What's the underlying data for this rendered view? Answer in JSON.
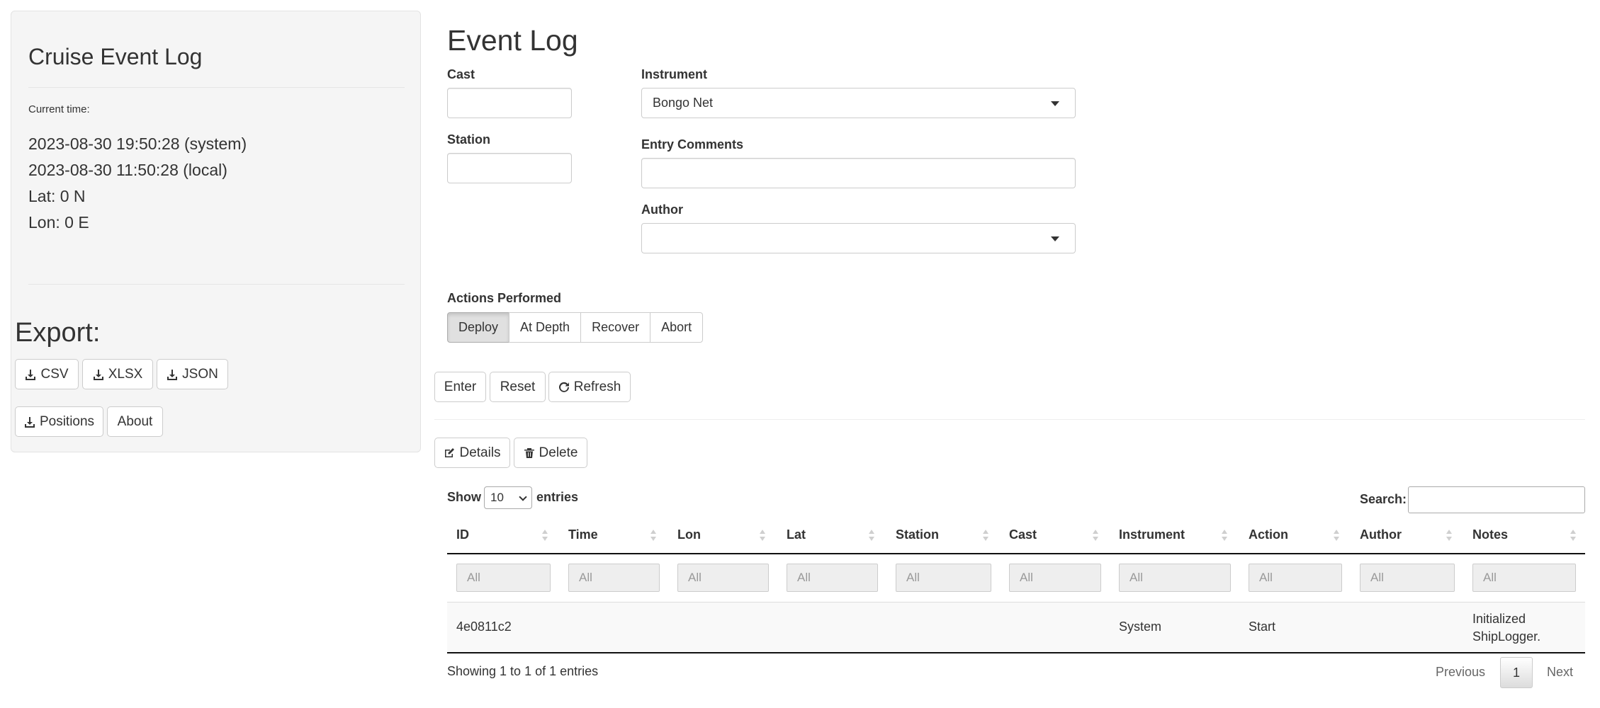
{
  "sidebar": {
    "title": "Cruise Event Log",
    "current_time_label": "Current time:",
    "system_time": "2023-08-30 19:50:28 (system)",
    "local_time": "2023-08-30 11:50:28 (local)",
    "lat": "Lat: 0 N",
    "lon": "Lon: 0 E",
    "export_heading": "Export:",
    "buttons": {
      "csv": "CSV",
      "xlsx": "XLSX",
      "json": "JSON",
      "positions": "Positions",
      "about": "About"
    }
  },
  "main": {
    "title": "Event Log",
    "form": {
      "cast_label": "Cast",
      "cast_value": "",
      "station_label": "Station",
      "station_value": "",
      "instrument_label": "Instrument",
      "instrument_value": "Bongo Net",
      "comments_label": "Entry Comments",
      "comments_value": "",
      "author_label": "Author",
      "author_value": ""
    },
    "actions": {
      "label": "Actions Performed",
      "options": [
        "Deploy",
        "At Depth",
        "Recover",
        "Abort"
      ],
      "selected": "Deploy"
    },
    "buttons": {
      "enter": "Enter",
      "reset": "Reset",
      "refresh": "Refresh",
      "details": "Details",
      "delete": "Delete"
    }
  },
  "table": {
    "show_label": "Show",
    "entries_label": "entries",
    "page_length": "10",
    "search_label": "Search:",
    "search_value": "",
    "columns": [
      "ID",
      "Time",
      "Lon",
      "Lat",
      "Station",
      "Cast",
      "Instrument",
      "Action",
      "Author",
      "Notes"
    ],
    "filter_placeholder": "All",
    "rows": [
      {
        "id": "4e0811c2",
        "time": "",
        "lon": "",
        "lat": "",
        "station": "",
        "cast": "",
        "instrument": "System",
        "action": "Start",
        "author": "",
        "notes": "Initialized ShipLogger."
      }
    ],
    "info": "Showing 1 to 1 of 1 entries",
    "pagination": {
      "previous": "Previous",
      "current": "1",
      "next": "Next"
    }
  },
  "icons": {
    "download": "download-icon",
    "refresh": "refresh-icon",
    "edit": "edit-icon",
    "trash": "trash-icon"
  }
}
